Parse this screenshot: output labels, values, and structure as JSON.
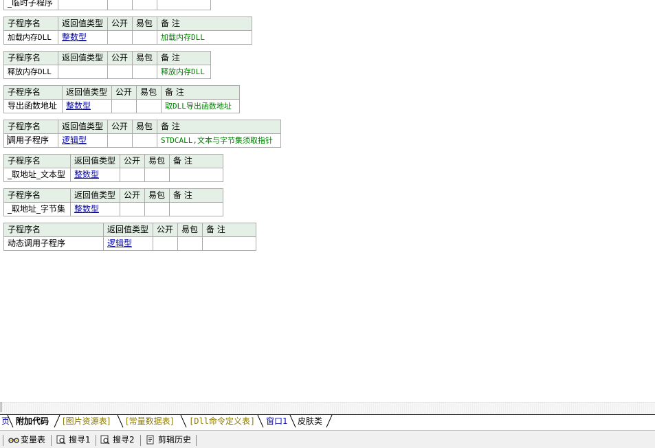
{
  "header_labels": {
    "name": "子程序名",
    "return_type": "返回值类型",
    "public": "公开",
    "easy_package": "易包",
    "note": "备 注"
  },
  "partial_top_row": {
    "name": "_临时子程序"
  },
  "subroutines": [
    {
      "name": "加载内存DLL",
      "return_type": "整数型",
      "public": "",
      "easy_package": "",
      "note": "加载内存DLL"
    },
    {
      "name": "释放内存DLL",
      "return_type": "",
      "public": "",
      "easy_package": "",
      "note": "释放内存DLL"
    },
    {
      "name": "导出函数地址",
      "return_type": "整数型",
      "public": "",
      "easy_package": "",
      "note": "取DLL导出函数地址"
    },
    {
      "name": "调用子程序",
      "return_type": "逻辑型",
      "public": "",
      "easy_package": "",
      "note": "STDCALL,文本与字节集须取指针"
    },
    {
      "name": "_取地址_文本型",
      "return_type": "整数型",
      "public": "",
      "easy_package": "",
      "note": ""
    },
    {
      "name": "_取地址_字节集",
      "return_type": "整数型",
      "public": "",
      "easy_package": "",
      "note": ""
    },
    {
      "name": "动态调用子程序",
      "return_type": "逻辑型",
      "public": "",
      "easy_package": "",
      "note": ""
    }
  ],
  "tabs": [
    {
      "label": "页",
      "style": "partial"
    },
    {
      "label": "附加代码",
      "style": "active"
    },
    {
      "label": "[图片资源表]",
      "style": "bracket"
    },
    {
      "label": "[常量数据表]",
      "style": "bracket"
    },
    {
      "label": "[Dll命令定义表]",
      "style": "bracket"
    },
    {
      "label": "窗口1",
      "style": "window"
    },
    {
      "label": "皮肤类",
      "style": "normal"
    }
  ],
  "bottom_tools": [
    {
      "label": "变量表",
      "icon": "glasses-icon"
    },
    {
      "label": "搜寻1",
      "icon": "search-window-icon"
    },
    {
      "label": "搜寻2",
      "icon": "search-window-icon"
    },
    {
      "label": "剪辑历史",
      "icon": "clipboard-history-icon"
    }
  ],
  "colors": {
    "header_bg": "#e4efe5",
    "grid_border": "#a9a9a9",
    "type_link": "#0a0aa8",
    "comment_green": "#008000",
    "bracket_tab": "#8b7a00",
    "window_tab": "#0a0aa8"
  }
}
